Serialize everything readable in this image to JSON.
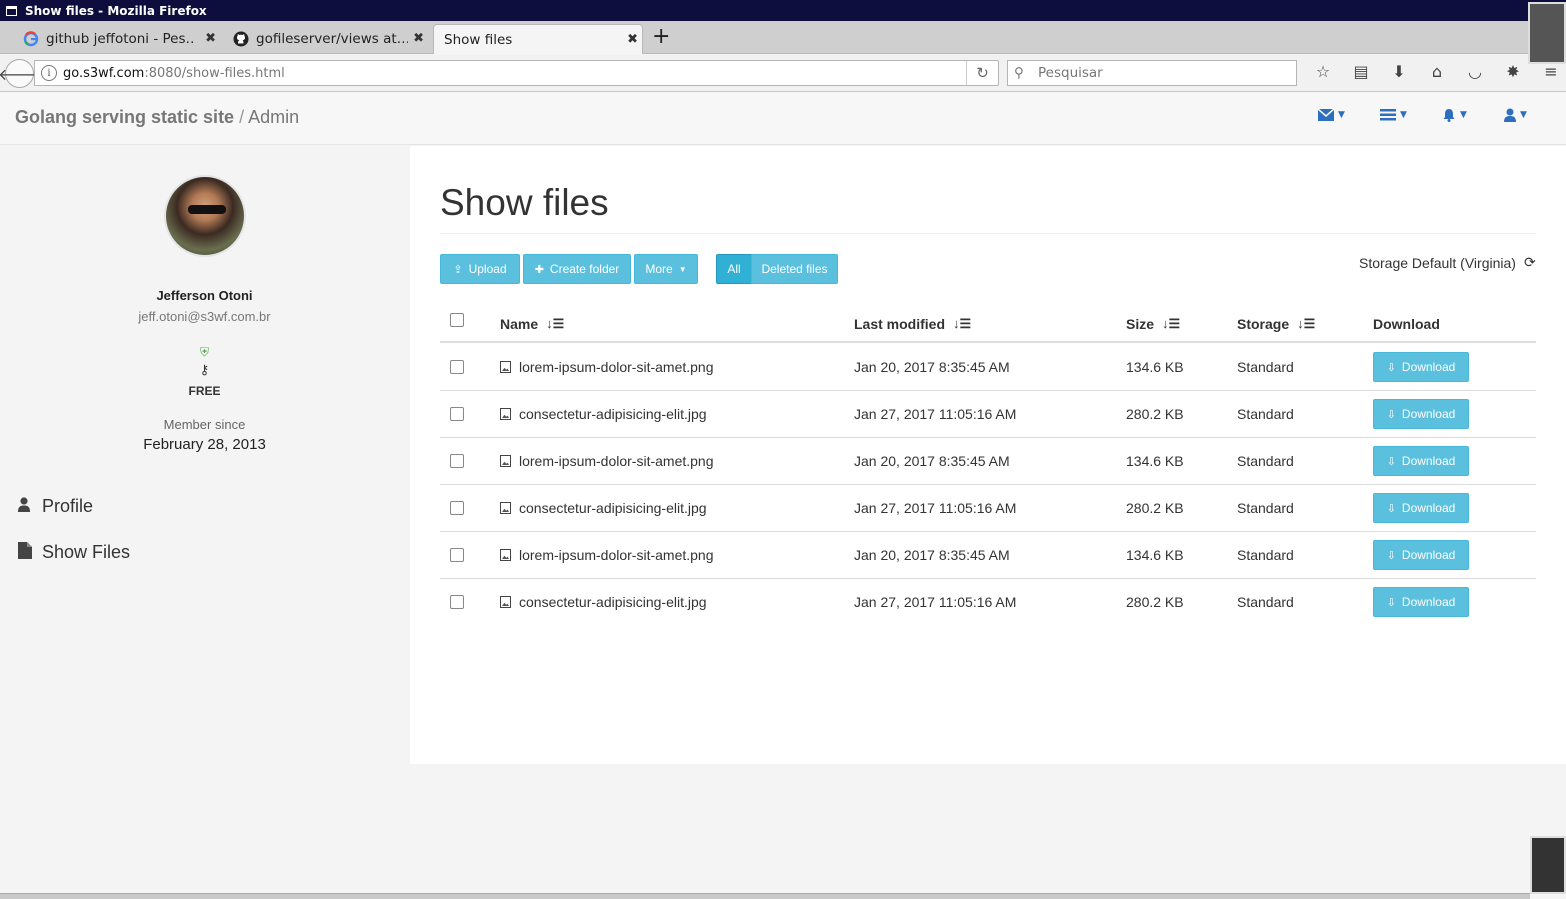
{
  "window": {
    "title": "Show files - Mozilla Firefox"
  },
  "tabs": [
    {
      "label": "github jeffotoni - Pes…",
      "favicon": "google-icon"
    },
    {
      "label": "gofileserver/views at…",
      "favicon": "github-icon"
    },
    {
      "label": "Show files",
      "favicon": ""
    }
  ],
  "new_tab_label": "+",
  "urlbar": {
    "host": "go.s3wf.com",
    "rest": ":8080/show-files.html"
  },
  "search": {
    "placeholder": "Pesquisar"
  },
  "app": {
    "brand_strong": "Golang serving static site",
    "brand_sep": "/",
    "brand_section": "Admin",
    "header_icons": [
      "envelope-icon",
      "list-icon",
      "bell-icon",
      "user-icon"
    ]
  },
  "profile": {
    "name": "Jefferson Otoni",
    "email": "jeff.otoni@s3wf.com.br",
    "plan": "FREE",
    "member_since_label": "Member since",
    "member_since_date": "February 28, 2013"
  },
  "sidebar_nav": [
    {
      "label": "Profile",
      "icon": "user-icon"
    },
    {
      "label": "Show Files",
      "icon": "file-icon"
    }
  ],
  "page": {
    "title": "Show files",
    "buttons": {
      "upload": "Upload",
      "create_folder": "Create folder",
      "more": "More",
      "all": "All",
      "deleted": "Deleted files"
    },
    "storage_label": "Storage Default (Virginia)"
  },
  "table": {
    "headers": {
      "name": "Name",
      "modified": "Last modified",
      "size": "Size",
      "storage": "Storage",
      "download": "Download"
    },
    "rows": [
      {
        "name": "lorem-ipsum-dolor-sit-amet.png",
        "modified": "Jan 20, 2017 8:35:45 AM",
        "size": "134.6 KB",
        "storage": "Standard",
        "download": "Download"
      },
      {
        "name": "consectetur-adipisicing-elit.jpg",
        "modified": "Jan 27, 2017 11:05:16 AM",
        "size": "280.2 KB",
        "storage": "Standard",
        "download": "Download"
      },
      {
        "name": "lorem-ipsum-dolor-sit-amet.png",
        "modified": "Jan 20, 2017 8:35:45 AM",
        "size": "134.6 KB",
        "storage": "Standard",
        "download": "Download"
      },
      {
        "name": "consectetur-adipisicing-elit.jpg",
        "modified": "Jan 27, 2017 11:05:16 AM",
        "size": "280.2 KB",
        "storage": "Standard",
        "download": "Download"
      },
      {
        "name": "lorem-ipsum-dolor-sit-amet.png",
        "modified": "Jan 20, 2017 8:35:45 AM",
        "size": "134.6 KB",
        "storage": "Standard",
        "download": "Download"
      },
      {
        "name": "consectetur-adipisicing-elit.jpg",
        "modified": "Jan 27, 2017 11:05:16 AM",
        "size": "280.2 KB",
        "storage": "Standard",
        "download": "Download"
      }
    ]
  },
  "colors": {
    "accent": "#5bc0de",
    "accent_active": "#31b0d5",
    "header_icon": "#2d6fbe",
    "titlebar": "#0e0e3e"
  }
}
